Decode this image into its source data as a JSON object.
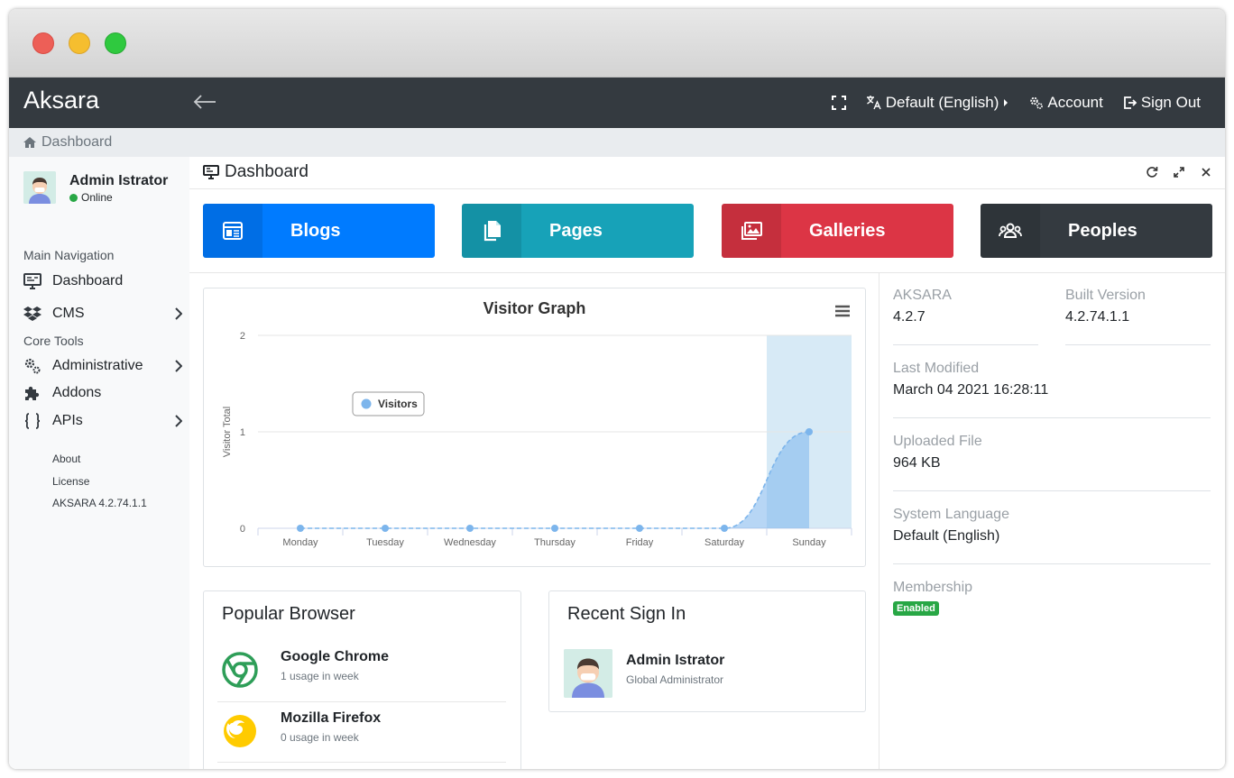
{
  "app": {
    "brand": "Aksara"
  },
  "navbar": {
    "language": "Default (English)",
    "account": "Account",
    "signout": "Sign Out"
  },
  "breadcrumb": {
    "home": "Dashboard"
  },
  "sidebar": {
    "user": {
      "name": "Admin Istrator",
      "status": "Online"
    },
    "sections": [
      {
        "title": "Main Navigation",
        "items": [
          {
            "label": "Dashboard"
          },
          {
            "label": "CMS"
          }
        ]
      },
      {
        "title": "Core Tools",
        "items": [
          {
            "label": "Administrative"
          },
          {
            "label": "Addons"
          },
          {
            "label": "APIs"
          }
        ]
      }
    ],
    "footer": {
      "about": "About",
      "license": "License",
      "version": "AKSARA 4.2.74.1.1"
    }
  },
  "card": {
    "title": "Dashboard"
  },
  "tiles": [
    {
      "label": "Blogs",
      "color": "#007bff"
    },
    {
      "label": "Pages",
      "color": "#17a2b8"
    },
    {
      "label": "Galleries",
      "color": "#dc3545"
    },
    {
      "label": "Peoples",
      "color": "#343a40"
    }
  ],
  "chart_data": {
    "type": "area",
    "title": "Visitor Graph",
    "ylabel": "Visitor Total",
    "xlabel": "",
    "categories": [
      "Monday",
      "Tuesday",
      "Wednesday",
      "Thursday",
      "Friday",
      "Saturday",
      "Sunday"
    ],
    "series": [
      {
        "name": "Visitors",
        "values": [
          0,
          0,
          0,
          0,
          0,
          0,
          1
        ]
      }
    ],
    "ylim": [
      0,
      2
    ],
    "yticks": [
      0,
      1,
      2
    ],
    "highlight_category": "Sunday",
    "legend": "top-left",
    "grid": true,
    "colors": {
      "series": "#7cb5ec",
      "highlight": "#d7eaf6"
    }
  },
  "popular_browser": {
    "title": "Popular Browser",
    "items": [
      {
        "name": "Google Chrome",
        "usage": "1 usage in week",
        "icon": "chrome-icon"
      },
      {
        "name": "Mozilla Firefox",
        "usage": "0 usage in week",
        "icon": "firefox-icon"
      }
    ]
  },
  "recent_signin": {
    "title": "Recent Sign In",
    "items": [
      {
        "name": "Admin Istrator",
        "role": "Global Administrator"
      }
    ]
  },
  "info": {
    "aksara_label": "AKSARA",
    "aksara_value": "4.2.7",
    "built_label": "Built Version",
    "built_value": "4.2.74.1.1",
    "modified_label": "Last Modified",
    "modified_value": "March 04 2021 16:28:11",
    "uploaded_label": "Uploaded File",
    "uploaded_value": "964 KB",
    "language_label": "System Language",
    "language_value": "Default (English)",
    "membership_label": "Membership",
    "membership_value": "Enabled"
  }
}
